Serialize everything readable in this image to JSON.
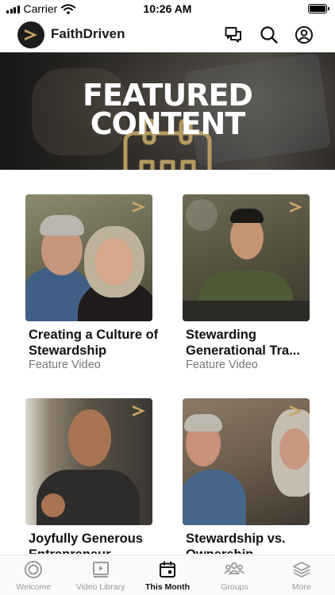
{
  "status_bar": {
    "carrier": "Carrier",
    "time": "10:26 AM"
  },
  "header": {
    "app_title": "FaithDriven",
    "icons": [
      "chat-icon",
      "search-icon",
      "account-icon"
    ]
  },
  "banner": {
    "title_line1": "FEATURED",
    "title_line2": "CONTENT",
    "accent_color": "#b59a62"
  },
  "cards": [
    {
      "title": "Creating a Culture of Stewardship",
      "subtitle": "Feature Video"
    },
    {
      "title": "Stewarding Generational Tra...",
      "subtitle": "Feature Video"
    },
    {
      "title": "Joyfully Generous Entrepreneur",
      "subtitle": ""
    },
    {
      "title": "Stewardship vs. Ownership",
      "subtitle": ""
    }
  ],
  "tab_bar": {
    "tabs": [
      {
        "label": "Welcome",
        "icon": "target-icon"
      },
      {
        "label": "Video Library",
        "icon": "video-library-icon"
      },
      {
        "label": "This Month",
        "icon": "calendar-icon",
        "active": true
      },
      {
        "label": "Groups",
        "icon": "groups-icon"
      },
      {
        "label": "More",
        "icon": "layers-icon"
      }
    ]
  },
  "colors": {
    "brand_gold": "#b59a62",
    "active_tab": "#111111",
    "inactive_tab": "#9a9a9a"
  }
}
